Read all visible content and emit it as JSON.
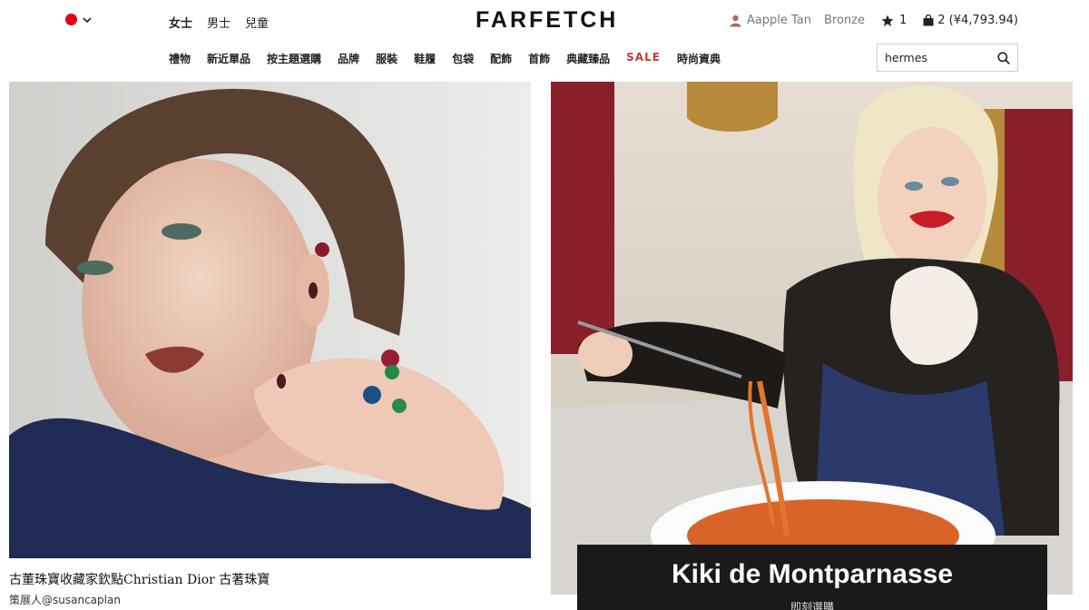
{
  "header": {
    "logo": "FARFETCH",
    "region_color": "#e60012",
    "gender_tabs": [
      {
        "label": "女士",
        "active": true
      },
      {
        "label": "男士",
        "active": false
      },
      {
        "label": "兒童",
        "active": false
      }
    ],
    "account": {
      "user_name": "Aapple Tan",
      "tier": "Bronze",
      "wishlist_count": "1",
      "bag_label": "2 (¥4,793.94)"
    },
    "categories": [
      {
        "label": "禮物"
      },
      {
        "label": "新近單品"
      },
      {
        "label": "按主題選購"
      },
      {
        "label": "品牌"
      },
      {
        "label": "服裝"
      },
      {
        "label": "鞋履"
      },
      {
        "label": "包袋"
      },
      {
        "label": "配飾"
      },
      {
        "label": "首飾"
      },
      {
        "label": "典藏臻品"
      },
      {
        "label": "SALE"
      },
      {
        "label": "時尚資典"
      }
    ],
    "search": {
      "value": "hermes",
      "placeholder": ""
    }
  },
  "cards": {
    "left": {
      "title": "古董珠寶收藏家欽點Christian Dior 古著珠寶",
      "subtitle": "策展人@susancaplan"
    },
    "right": {
      "overlay_title": "Kiki de Montparnasse",
      "overlay_sub": "即刻選購"
    }
  },
  "colors": {
    "accent_sale": "#d0353a",
    "overlay_bg": "#1a1a1a"
  }
}
